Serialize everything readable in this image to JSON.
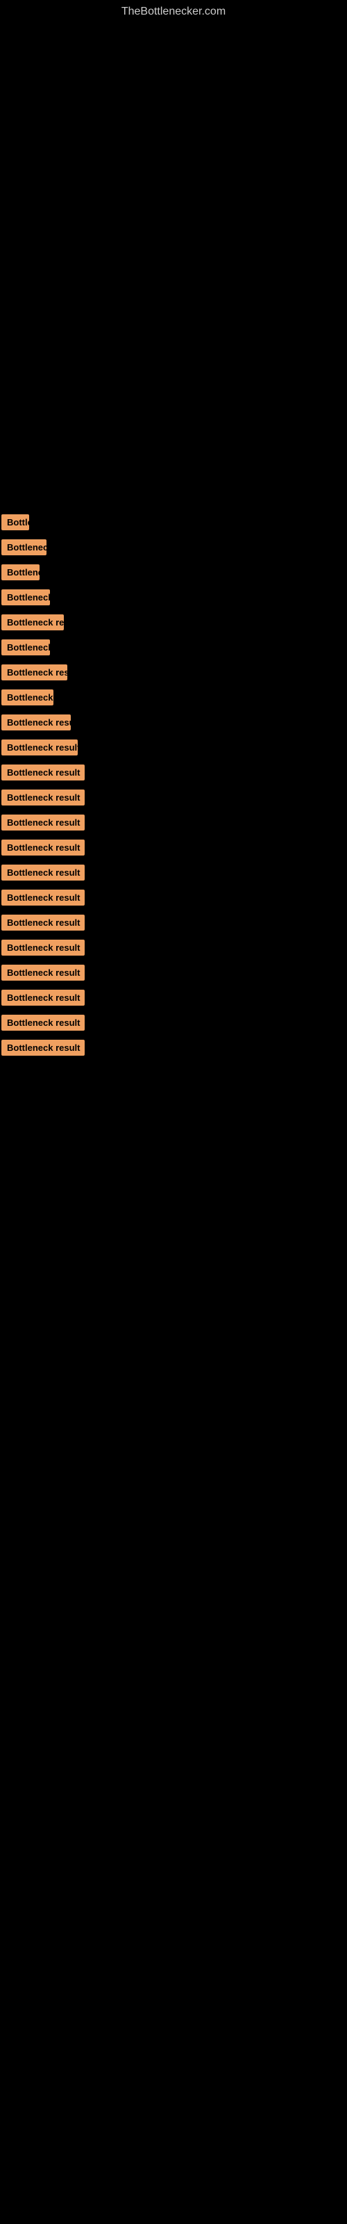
{
  "site": {
    "title": "TheBottlenecker.com"
  },
  "bottleneck_items": [
    {
      "id": 1,
      "label": "Bottleneck result",
      "width_class": "w-40"
    },
    {
      "id": 2,
      "label": "Bottleneck result",
      "width_class": "w-65"
    },
    {
      "id": 3,
      "label": "Bottleneck result",
      "width_class": "w-55"
    },
    {
      "id": 4,
      "label": "Bottleneck result",
      "width_class": "w-70"
    },
    {
      "id": 5,
      "label": "Bottleneck result",
      "width_class": "w-90"
    },
    {
      "id": 6,
      "label": "Bottleneck result",
      "width_class": "w-70b"
    },
    {
      "id": 7,
      "label": "Bottleneck result",
      "width_class": "w-95"
    },
    {
      "id": 8,
      "label": "Bottleneck result",
      "width_class": "w-75"
    },
    {
      "id": 9,
      "label": "Bottleneck result",
      "width_class": "w-100"
    },
    {
      "id": 10,
      "label": "Bottleneck result",
      "width_class": "w-110"
    },
    {
      "id": 11,
      "label": "Bottleneck result",
      "width_class": "w-120"
    },
    {
      "id": 12,
      "label": "Bottleneck result",
      "width_class": "w-120b"
    },
    {
      "id": 13,
      "label": "Bottleneck result",
      "width_class": "w-120c"
    },
    {
      "id": 14,
      "label": "Bottleneck result",
      "width_class": "w-120d"
    },
    {
      "id": 15,
      "label": "Bottleneck result",
      "width_class": "w-120e"
    },
    {
      "id": 16,
      "label": "Bottleneck result",
      "width_class": "w-120f"
    },
    {
      "id": 17,
      "label": "Bottleneck result",
      "width_class": "w-120g"
    },
    {
      "id": 18,
      "label": "Bottleneck result",
      "width_class": "w-120h"
    },
    {
      "id": 19,
      "label": "Bottleneck result",
      "width_class": "w-120i"
    },
    {
      "id": 20,
      "label": "Bottleneck result",
      "width_class": "w-120j"
    },
    {
      "id": 21,
      "label": "Bottleneck result",
      "width_class": "w-120k"
    },
    {
      "id": 22,
      "label": "Bottleneck result",
      "width_class": "w-120l"
    }
  ]
}
